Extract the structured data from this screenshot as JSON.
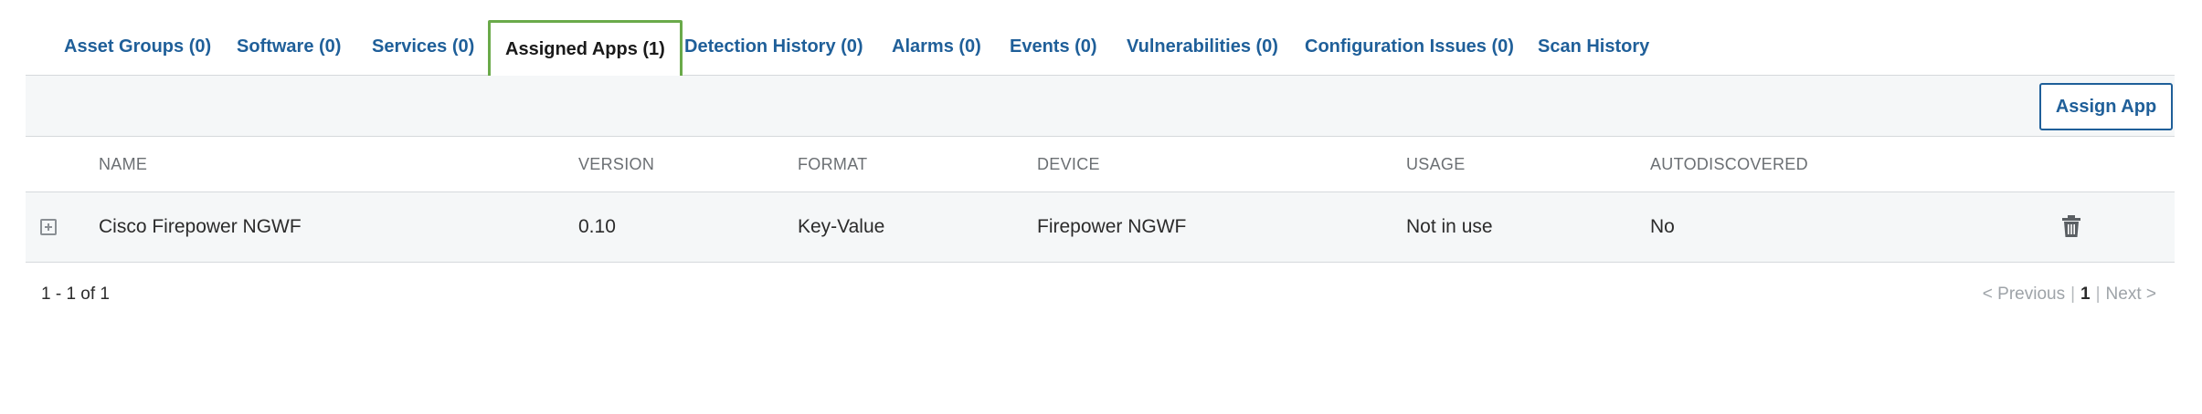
{
  "tabs": [
    {
      "label": "Asset Groups (0)"
    },
    {
      "label": "Software (0)"
    },
    {
      "label": "Services (0)"
    },
    {
      "label": "Assigned Apps (1)",
      "active": true
    },
    {
      "label": "Detection History (0)"
    },
    {
      "label": "Alarms (0)"
    },
    {
      "label": "Events (0)"
    },
    {
      "label": "Vulnerabilities (0)"
    },
    {
      "label": "Configuration Issues (0)"
    },
    {
      "label": "Scan History"
    }
  ],
  "toolbar": {
    "assign_label": "Assign App"
  },
  "table": {
    "columns": [
      "NAME",
      "VERSION",
      "FORMAT",
      "DEVICE",
      "USAGE",
      "AUTODISCOVERED"
    ],
    "rows": [
      {
        "name": "Cisco Firepower NGWF",
        "version": "0.10",
        "format": "Key-Value",
        "device": "Firepower NGWF",
        "usage": "Not in use",
        "autodiscovered": "No"
      }
    ]
  },
  "footer": {
    "range": "1 - 1 of 1"
  },
  "pager": {
    "previous": "< Previous",
    "separator": "|",
    "current": "1",
    "next": "Next >"
  },
  "icons": {
    "expand": "expand-plus-icon",
    "delete": "trash-icon"
  },
  "colors": {
    "link": "#1f5f99",
    "active_border": "#6aaa4a"
  }
}
